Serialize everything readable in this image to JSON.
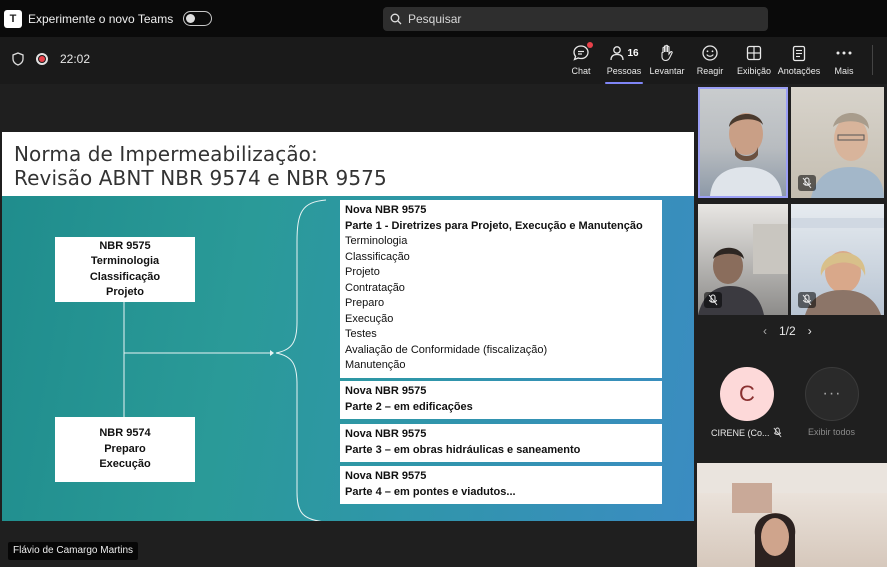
{
  "titlebar": {
    "app_icon": "teams-logo-icon",
    "try_new_label": "Experimente o novo Teams",
    "search_placeholder": "Pesquisar"
  },
  "call": {
    "timer": "22:02",
    "record_color": "#e8414a"
  },
  "toolbar": {
    "chat": "Chat",
    "people": "Pessoas",
    "people_count": "16",
    "raise": "Levantar",
    "react": "Reagir",
    "view": "Exibição",
    "notes": "Anotações",
    "more": "Mais",
    "accent": "#7f85f5"
  },
  "slide": {
    "title_line1": "Norma de Impermeabilização:",
    "title_line2": "Revisão ABNT NBR 9574 e NBR 9575",
    "left_top": [
      "NBR 9575",
      "Terminologia",
      "Classificação",
      "Projeto"
    ],
    "left_bottom": [
      "NBR 9574",
      "Preparo",
      "Execução"
    ],
    "part1_title": "Nova NBR 9575",
    "part1_subtitle": "Parte 1 - Diretrizes para Projeto, Execução e Manutenção",
    "part1_items": [
      "Terminologia",
      "Classificação",
      "Projeto",
      "Contratação",
      "Preparo",
      "Execução",
      "Testes",
      "Avaliação de Conformidade (fiscalização)",
      "Manutenção"
    ],
    "part2": [
      "Nova NBR 9575",
      "Parte 2 – em edificações"
    ],
    "part3": [
      "Nova NBR 9575",
      "Parte 3 – em obras hidráulicas e saneamento"
    ],
    "part4": [
      "Nova NBR 9575",
      "Parte 4 – em pontes e viadutos..."
    ]
  },
  "presenter_name": "Flávio de Camargo Martins",
  "sidebar": {
    "page": "1/2",
    "avatar_initial": "C",
    "avatar_name": "CIRENE (Co...",
    "show_all": "Exibir todos"
  }
}
